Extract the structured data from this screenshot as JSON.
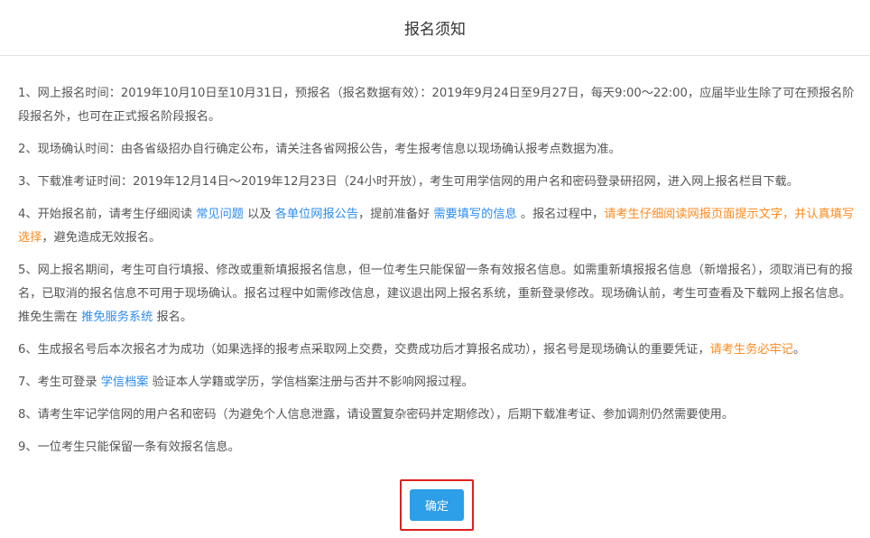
{
  "header": {
    "title": "报名须知"
  },
  "items": [
    {
      "t1": "1、网上报名时间：2019年10月10日至10月31日，预报名（报名数据有效）：2019年9月24日至9月27日，每天9:00～22:00，应届毕业生除了可在预报名阶段报名外，也可在正式报名阶段报名。"
    },
    {
      "t1": "2、现场确认时间：由各省级招办自行确定公布，请关注各省网报公告，考生报考信息以现场确认报考点数据为准。"
    },
    {
      "t1": "3、下载准考证时间：2019年12月14日～2019年12月23日（24小时开放），考生可用学信网的用户名和密码登录研招网，进入网上报名栏目下载。"
    },
    {
      "t1": "4、开始报名前，请考生仔细阅读 ",
      "link1": "常见问题",
      "t2": " 以及 ",
      "link2": "各单位网报公告",
      "t3": "，提前准备好 ",
      "link3": "需要填写的信息",
      "t4": " 。报名过程中，",
      "warn": "请考生仔细阅读网报页面提示文字，并认真填写选择",
      "t5": "，避免造成无效报名。"
    },
    {
      "t1": "5、网上报名期间，考生可自行填报、修改或重新填报报名信息，但一位考生只能保留一条有效报名信息。如需重新填报报名信息（新增报名），须取消已有的报名，已取消的报名信息不可用于现场确认。报名过程中如需修改信息，建议退出网上报名系统，重新登录修改。现场确认前，考生可查看及下载网上报名信息。推免生需在 ",
      "link1": "推免服务系统",
      "t2": " 报名。"
    },
    {
      "t1": "6、生成报名号后本次报名才为成功（如果选择的报考点采取网上交费，交费成功后才算报名成功），报名号是现场确认的重要凭证，",
      "warn": "请考生务必牢记",
      "t2": "。"
    },
    {
      "t1": "7、考生可登录 ",
      "link1": "学信档案",
      "t2": " 验证本人学籍或学历，学信档案注册与否并不影响网报过程。"
    },
    {
      "t1": "8、请考生牢记学信网的用户名和密码（为避免个人信息泄露，请设置复杂密码并定期修改），后期下载准考证、参加调剂仍然需要使用。"
    },
    {
      "t1": "9、一位考生只能保留一条有效报名信息。"
    }
  ],
  "footer": {
    "confirm_label": "确定"
  },
  "colors": {
    "link": "#2d8cf0",
    "warning": "#ff8a1f",
    "button": "#2d9ee8",
    "highlight_border": "#e02020"
  }
}
